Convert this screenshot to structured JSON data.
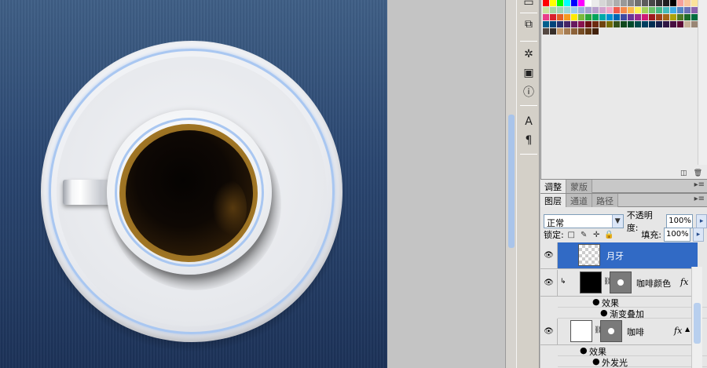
{
  "swatch_colors": [
    "#ff0000",
    "#ffff00",
    "#00ff00",
    "#00ffff",
    "#0000ff",
    "#ff00ff",
    "#ffffff",
    "#ebebeb",
    "#d6d6d6",
    "#c2c2c2",
    "#adadad",
    "#999999",
    "#858585",
    "#707070",
    "#5c5c5c",
    "#474747",
    "#333333",
    "#1f1f1f",
    "#000000",
    "#f4a09c",
    "#f8c49b",
    "#fbe29b",
    "#fffea0",
    "#c8e39f",
    "#a6d7a2",
    "#9fd4b6",
    "#9ed7d8",
    "#9bcdef",
    "#9cb3dc",
    "#a8a3d0",
    "#b7a0cc",
    "#d2a2cd",
    "#f2a5c6",
    "#f15a4b",
    "#f48a4c",
    "#fcb84c",
    "#fff256",
    "#a4d15c",
    "#6ac26a",
    "#46b883",
    "#45bcbc",
    "#40aee4",
    "#5386c6",
    "#6c71b7",
    "#8b62ad",
    "#b067ac",
    "#e83d8a",
    "#d8202b",
    "#e45f25",
    "#f69a1f",
    "#ffea00",
    "#7ab93d",
    "#2aa53b",
    "#00a35b",
    "#00a9a9",
    "#0090d2",
    "#0066b3",
    "#3e4ba1",
    "#6a3596",
    "#9a2a8e",
    "#cf1b76",
    "#9d1a1e",
    "#a0401a",
    "#a6671a",
    "#aca20a",
    "#4f7a26",
    "#1b6b2a",
    "#006c40",
    "#006e6f",
    "#005e8d",
    "#00447a",
    "#262f6e",
    "#462466",
    "#67195f",
    "#88124f",
    "#6a0f12",
    "#6c2a0f",
    "#704410",
    "#756e06",
    "#34521a",
    "#0f481c",
    "#00492b",
    "#004a4b",
    "#003f5f",
    "#002d52",
    "#181e4a",
    "#2f1644",
    "#460e40",
    "#5b0a34",
    "#c7b299",
    "#998675",
    "#736357",
    "#534741",
    "#372f2a",
    "#c69c6d",
    "#a67c52",
    "#8c6239",
    "#754c24",
    "#603913",
    "#42210b"
  ],
  "tabs_adjust": [
    "调整",
    "蒙版"
  ],
  "tabs_layers": [
    "图层",
    "通道",
    "路径"
  ],
  "layers_panel": {
    "blend_mode": "正常",
    "opacity_label": "不透明度:",
    "opacity_value": "100%",
    "lock_label": "锁定:",
    "fill_label": "填充:",
    "fill_value": "100%"
  },
  "layers": [
    {
      "name": "月牙",
      "selected": true
    },
    {
      "name": "咖啡颜色",
      "effects_label": "效果",
      "effect": "渐变叠加"
    },
    {
      "name": "咖啡",
      "effects_label": "效果",
      "effect": "外发光"
    }
  ],
  "icons": {
    "fx": "fx",
    "eye": "eye-icon",
    "panel_menu": "panel-menu-icon"
  }
}
